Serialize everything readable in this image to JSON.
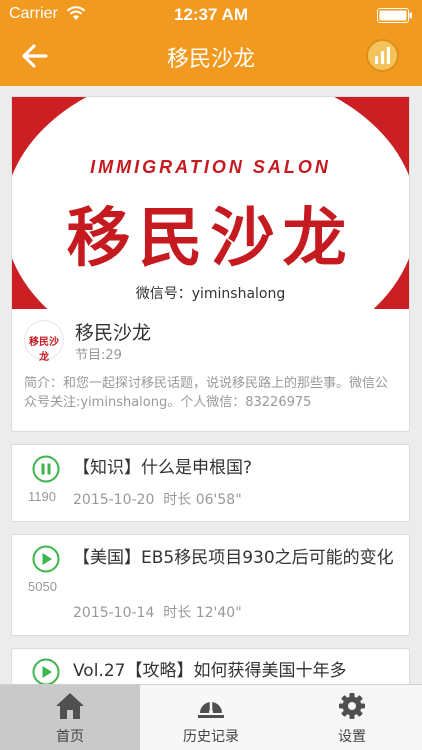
{
  "status_bar": {
    "carrier": "Carrier",
    "time": "12:37 AM"
  },
  "nav": {
    "title": "移民沙龙",
    "back_icon": "back-arrow-icon",
    "stats_icon": "bar-chart-icon"
  },
  "program": {
    "banner_en": "IMMIGRATION SALON",
    "banner_cn": "移民沙龙",
    "banner_wechat": "微信号：yiminshalong",
    "logo_text": "移民沙龙",
    "name": "移民沙龙",
    "episode_count": "节目:29",
    "description": "简介：和您一起探讨移民话题，说说移民路上的那些事。微信公众号关注:yiminshalong。个人微信：83226975"
  },
  "episodes": [
    {
      "title": "【知识】什么是申根国?",
      "count": "1190",
      "date": "2015-10-20",
      "duration": "时长 06'58\"",
      "state": "playing",
      "icon": "pause-icon"
    },
    {
      "title": "【美国】EB5移民项目930之后可能的变化",
      "count": "5050",
      "date": "2015-10-14",
      "duration": "时长 12'40\"",
      "state": "paused",
      "icon": "play-icon"
    },
    {
      "title": "Vol.27【攻略】如何获得美国十年多",
      "count": "",
      "date": "",
      "duration": "",
      "state": "paused",
      "icon": "play-icon"
    }
  ],
  "tabs": [
    {
      "label": "首页",
      "icon": "home-icon",
      "active": true
    },
    {
      "label": "历史记录",
      "icon": "history-icon",
      "active": false
    },
    {
      "label": "设置",
      "icon": "gear-icon",
      "active": false
    }
  ],
  "colors": {
    "accent": "#f29a1f",
    "play_green": "#3cb54a",
    "brand_red": "#c41a20"
  }
}
